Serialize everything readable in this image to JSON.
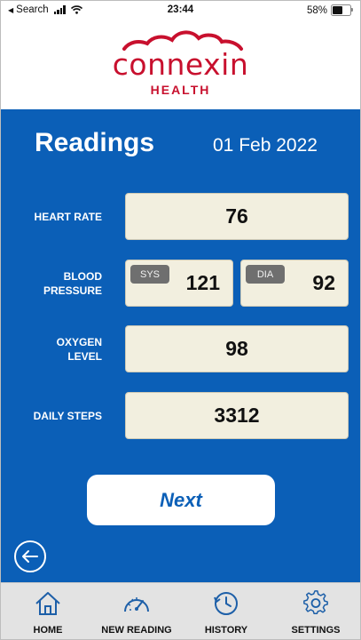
{
  "status_bar": {
    "carrier": "Search",
    "time": "23:44",
    "battery_percent": "58%",
    "battery_level": 0.58
  },
  "logo": {
    "wordmark": "connexin",
    "subtitle": "HEALTH",
    "color": "#c8102e"
  },
  "screen": {
    "title": "Readings",
    "date": "01 Feb 2022"
  },
  "readings": {
    "heart_rate": {
      "label_line1": "HEART RATE",
      "value": "76"
    },
    "blood_pressure": {
      "label_line1": "BLOOD",
      "label_line2": "PRESSURE",
      "sys_tag": "SYS",
      "sys_value": "121",
      "dia_tag": "DIA",
      "dia_value": "92"
    },
    "oxygen_level": {
      "label_line1": "OXYGEN",
      "label_line2": "LEVEL",
      "value": "98"
    },
    "daily_steps": {
      "label_line1": "DAILY STEPS",
      "value": "3312"
    }
  },
  "buttons": {
    "next_label": "Next"
  },
  "tabs": [
    {
      "label": "HOME",
      "icon": "home-icon"
    },
    {
      "label": "NEW READING",
      "icon": "gauge-icon"
    },
    {
      "label": "HISTORY",
      "icon": "history-icon"
    },
    {
      "label": "SETTINGS",
      "icon": "gear-icon"
    }
  ],
  "colors": {
    "panel_blue": "#0b5fb7",
    "value_box": "#f2efdf",
    "tag_gray": "#6f6f6f",
    "tab_bar": "#e3e3e3",
    "brand_red": "#c8102e"
  }
}
